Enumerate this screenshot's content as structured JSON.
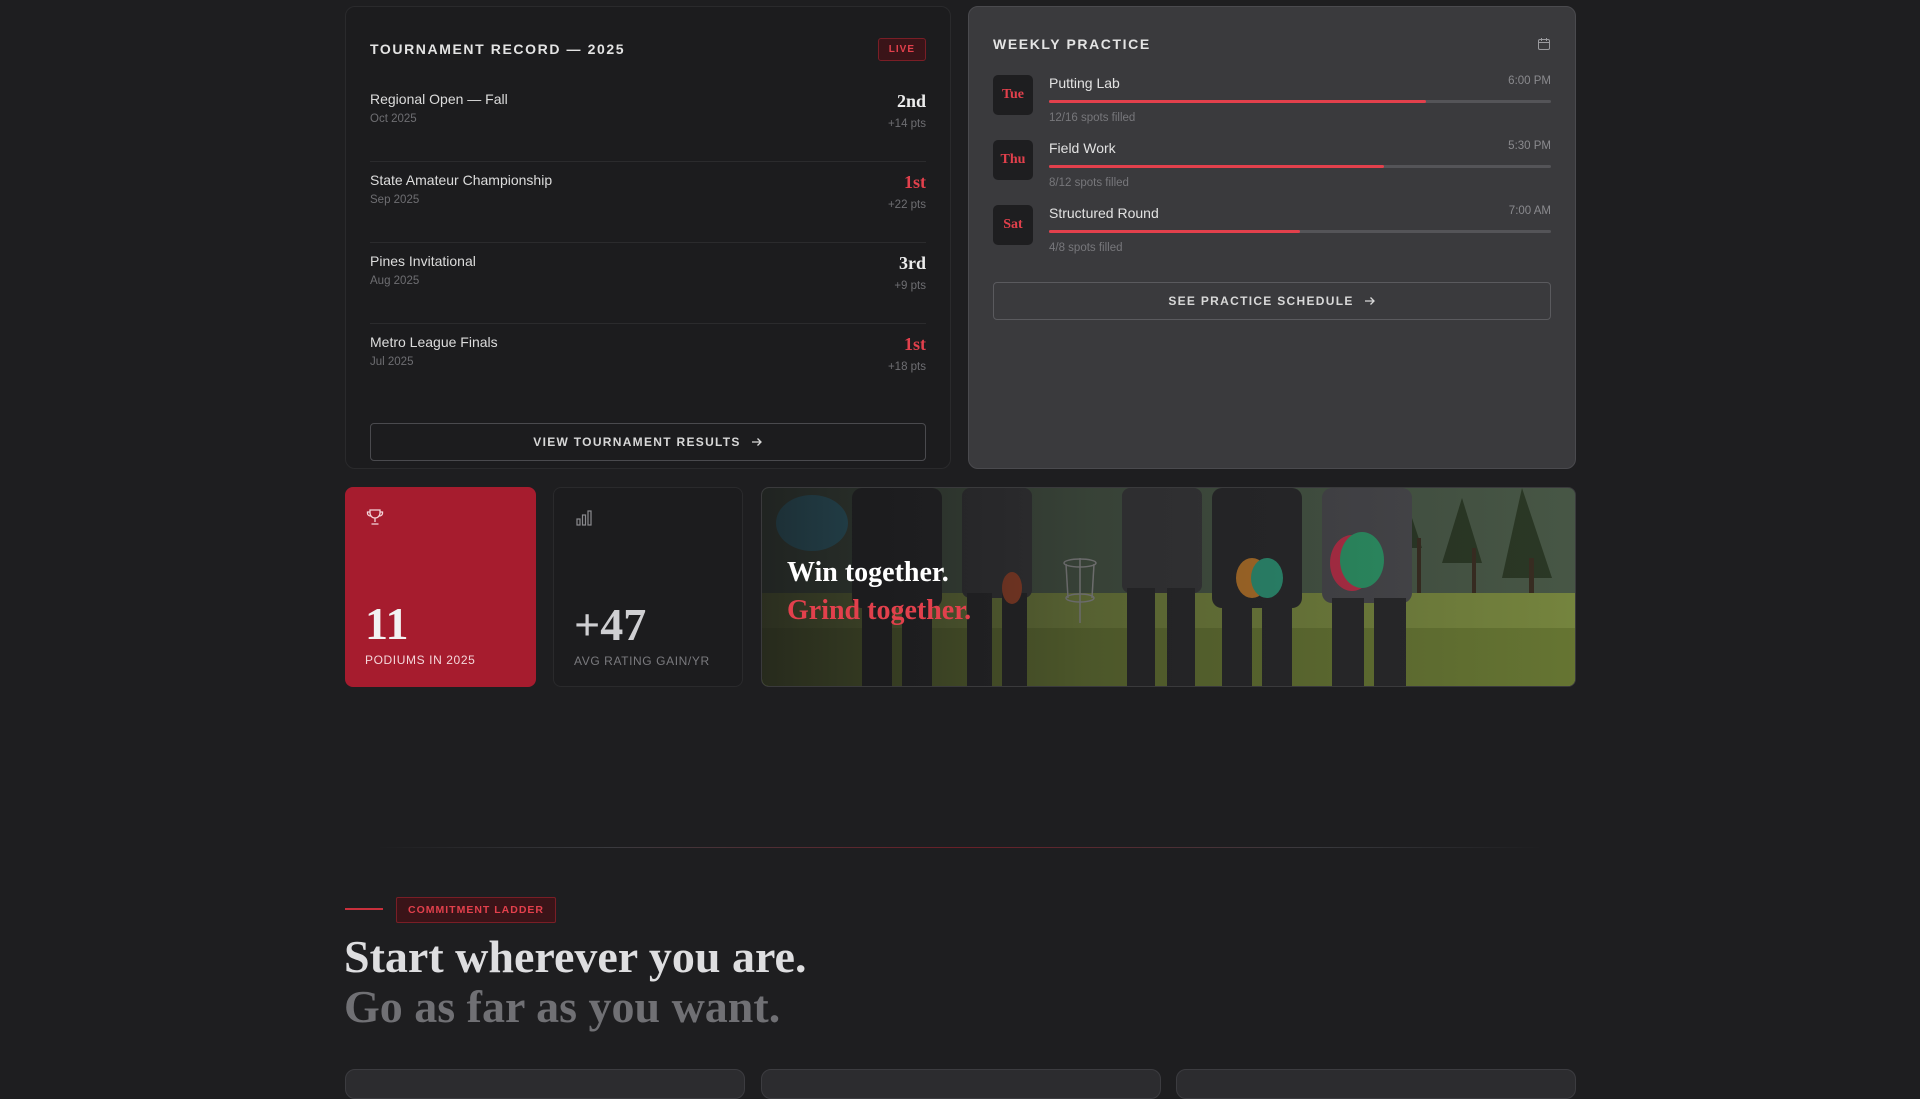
{
  "tournament": {
    "title": "TOURNAMENT RECORD — 2025",
    "badge": "LIVE",
    "rows": [
      {
        "name": "Regional Open — Fall",
        "date": "Oct 2025",
        "place": "2nd",
        "pts": "+14 pts"
      },
      {
        "name": "State Amateur Championship",
        "date": "Sep 2025",
        "place": "1st",
        "pts": "+22 pts"
      },
      {
        "name": "Pines Invitational",
        "date": "Aug 2025",
        "place": "3rd",
        "pts": "+9 pts"
      },
      {
        "name": "Metro League Finals",
        "date": "Jul 2025",
        "place": "1st",
        "pts": "+18 pts"
      }
    ],
    "button": "VIEW TOURNAMENT RESULTS"
  },
  "practice": {
    "title": "WEEKLY PRACTICE",
    "icon": "calendar-icon",
    "sessions": [
      {
        "day": "Tue",
        "name": "Putting Lab",
        "time": "6:00 PM",
        "spots": "12/16 spots filled",
        "fill": 0.75
      },
      {
        "day": "Thu",
        "name": "Field Work",
        "time": "5:30 PM",
        "spots": "8/12 spots filled",
        "fill": 0.667
      },
      {
        "day": "Sat",
        "name": "Structured Round",
        "time": "7:00 AM",
        "spots": "4/8 spots filled",
        "fill": 0.5
      }
    ],
    "button": "SEE PRACTICE SCHEDULE"
  },
  "stats": {
    "podiums": {
      "value": "11",
      "label": "PODIUMS IN 2025",
      "icon": "trophy-icon"
    },
    "rating": {
      "value": "+47",
      "label": "AVG RATING GAIN/YR",
      "icon": "bar-chart-icon"
    }
  },
  "banner": {
    "line1": "Win together.",
    "line2": "Grind together."
  },
  "commitment": {
    "tag": "COMMITMENT LADDER",
    "headline1": "Start wherever you are.",
    "headline2": "Go as far as you want."
  },
  "colors": {
    "accent": "#e2404c",
    "accent_dark": "#a61c2e",
    "background": "#1e1e20"
  }
}
